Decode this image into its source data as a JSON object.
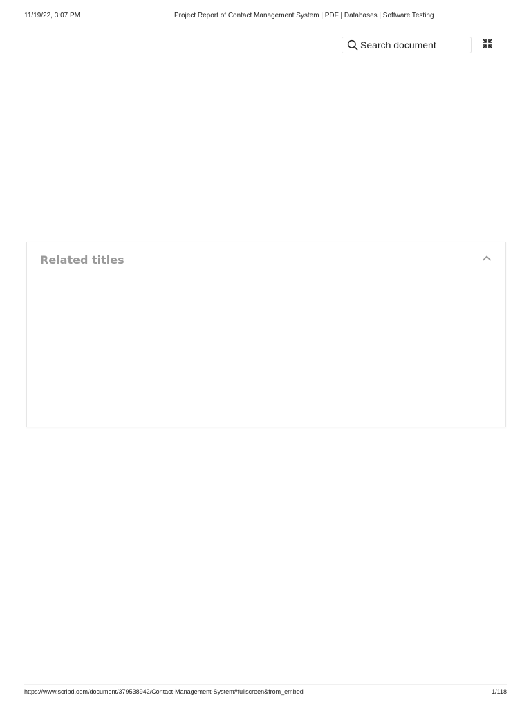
{
  "print_header": {
    "datetime": "11/19/22, 3:07 PM",
    "title": "Project Report of Contact Management System | PDF | Databases | Software Testing"
  },
  "toolbar": {
    "search_placeholder": "Search document",
    "search_icon": "search-icon",
    "fullscreen_icon": "exit-fullscreen-icon"
  },
  "related_titles": {
    "heading": "Related titles",
    "toggle_icon": "chevron-up-icon"
  },
  "print_footer": {
    "url": "https://www.scribd.com/document/379538942/Contact-Management-System#fullscreen&from_embed",
    "page_indicator": "1/118"
  }
}
